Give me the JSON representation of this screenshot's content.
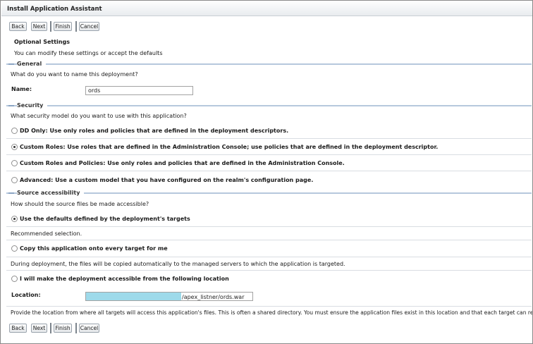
{
  "window": {
    "title": "Install Application Assistant"
  },
  "toolbar": {
    "back": "Back",
    "next": "Next",
    "finish": "Finish",
    "cancel": "Cancel"
  },
  "optional": {
    "title": "Optional Settings",
    "subtitle": "You can modify these settings or accept the defaults"
  },
  "general": {
    "title": "General",
    "question": "What do you want to name this deployment?",
    "name_label": "Name:",
    "name_value": "ords"
  },
  "security": {
    "title": "Security",
    "question": "What security model do you want to use with this application?",
    "options": [
      {
        "label": "DD Only: Use only roles and policies that are defined in the deployment descriptors.",
        "selected": false
      },
      {
        "label": "Custom Roles: Use roles that are defined in the Administration Console; use policies that are defined in the deployment descriptor.",
        "selected": true
      },
      {
        "label": "Custom Roles and Policies: Use only roles and policies that are defined in the Administration Console.",
        "selected": false
      },
      {
        "label": "Advanced: Use a custom model that you have configured on the realm's configuration page.",
        "selected": false
      }
    ]
  },
  "source": {
    "title": "Source accessibility",
    "question": "How should the source files be made accessible?",
    "opt1": "Use the defaults defined by the deployment's targets",
    "opt1_selected": true,
    "opt1_note": "Recommended selection.",
    "opt2": "Copy this application onto every target for me",
    "opt2_selected": false,
    "opt2_note": "During deployment, the files will be copied automatically to the managed servers to which the application is targeted.",
    "opt3": "I will make the deployment accessible from the following location",
    "opt3_selected": false,
    "location_label": "Location:",
    "location_value": "/apex_listner/ords.war",
    "location_note": "Provide the location from where all targets will access this application's files. This is often a shared directory. You must ensure the application files exist in this location and that each target can reach the location."
  }
}
